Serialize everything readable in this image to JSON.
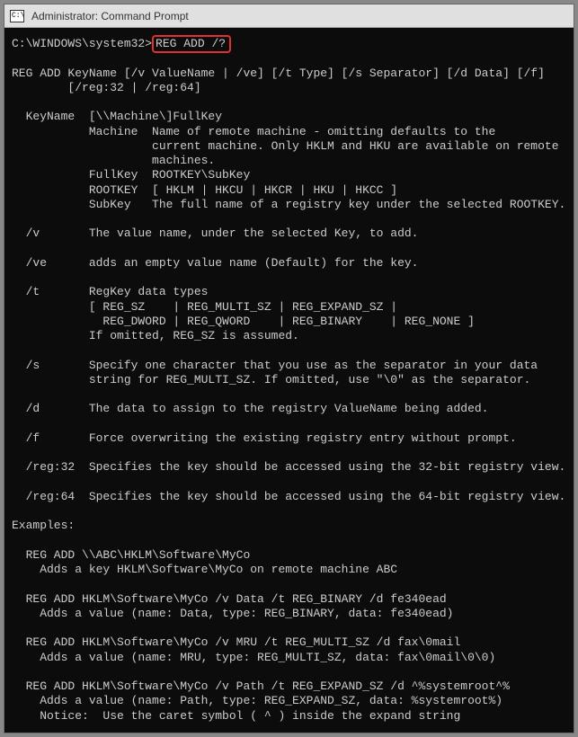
{
  "window": {
    "title": "Administrator: Command Prompt",
    "icon_label": "C:\\"
  },
  "terminal": {
    "prompt": "C:\\WINDOWS\\system32>",
    "command": "REG ADD /?",
    "output_lines": [
      "",
      "REG ADD KeyName [/v ValueName | /ve] [/t Type] [/s Separator] [/d Data] [/f]",
      "        [/reg:32 | /reg:64]",
      "",
      "  KeyName  [\\\\Machine\\]FullKey",
      "           Machine  Name of remote machine - omitting defaults to the",
      "                    current machine. Only HKLM and HKU are available on remote",
      "                    machines.",
      "           FullKey  ROOTKEY\\SubKey",
      "           ROOTKEY  [ HKLM | HKCU | HKCR | HKU | HKCC ]",
      "           SubKey   The full name of a registry key under the selected ROOTKEY.",
      "",
      "  /v       The value name, under the selected Key, to add.",
      "",
      "  /ve      adds an empty value name (Default) for the key.",
      "",
      "  /t       RegKey data types",
      "           [ REG_SZ    | REG_MULTI_SZ | REG_EXPAND_SZ |",
      "             REG_DWORD | REG_QWORD    | REG_BINARY    | REG_NONE ]",
      "           If omitted, REG_SZ is assumed.",
      "",
      "  /s       Specify one character that you use as the separator in your data",
      "           string for REG_MULTI_SZ. If omitted, use \"\\0\" as the separator.",
      "",
      "  /d       The data to assign to the registry ValueName being added.",
      "",
      "  /f       Force overwriting the existing registry entry without prompt.",
      "",
      "  /reg:32  Specifies the key should be accessed using the 32-bit registry view.",
      "",
      "  /reg:64  Specifies the key should be accessed using the 64-bit registry view.",
      "",
      "Examples:",
      "",
      "  REG ADD \\\\ABC\\HKLM\\Software\\MyCo",
      "    Adds a key HKLM\\Software\\MyCo on remote machine ABC",
      "",
      "  REG ADD HKLM\\Software\\MyCo /v Data /t REG_BINARY /d fe340ead",
      "    Adds a value (name: Data, type: REG_BINARY, data: fe340ead)",
      "",
      "  REG ADD HKLM\\Software\\MyCo /v MRU /t REG_MULTI_SZ /d fax\\0mail",
      "    Adds a value (name: MRU, type: REG_MULTI_SZ, data: fax\\0mail\\0\\0)",
      "",
      "  REG ADD HKLM\\Software\\MyCo /v Path /t REG_EXPAND_SZ /d ^%systemroot^%",
      "    Adds a value (name: Path, type: REG_EXPAND_SZ, data: %systemroot%)",
      "    Notice:  Use the caret symbol ( ^ ) inside the expand string"
    ]
  }
}
